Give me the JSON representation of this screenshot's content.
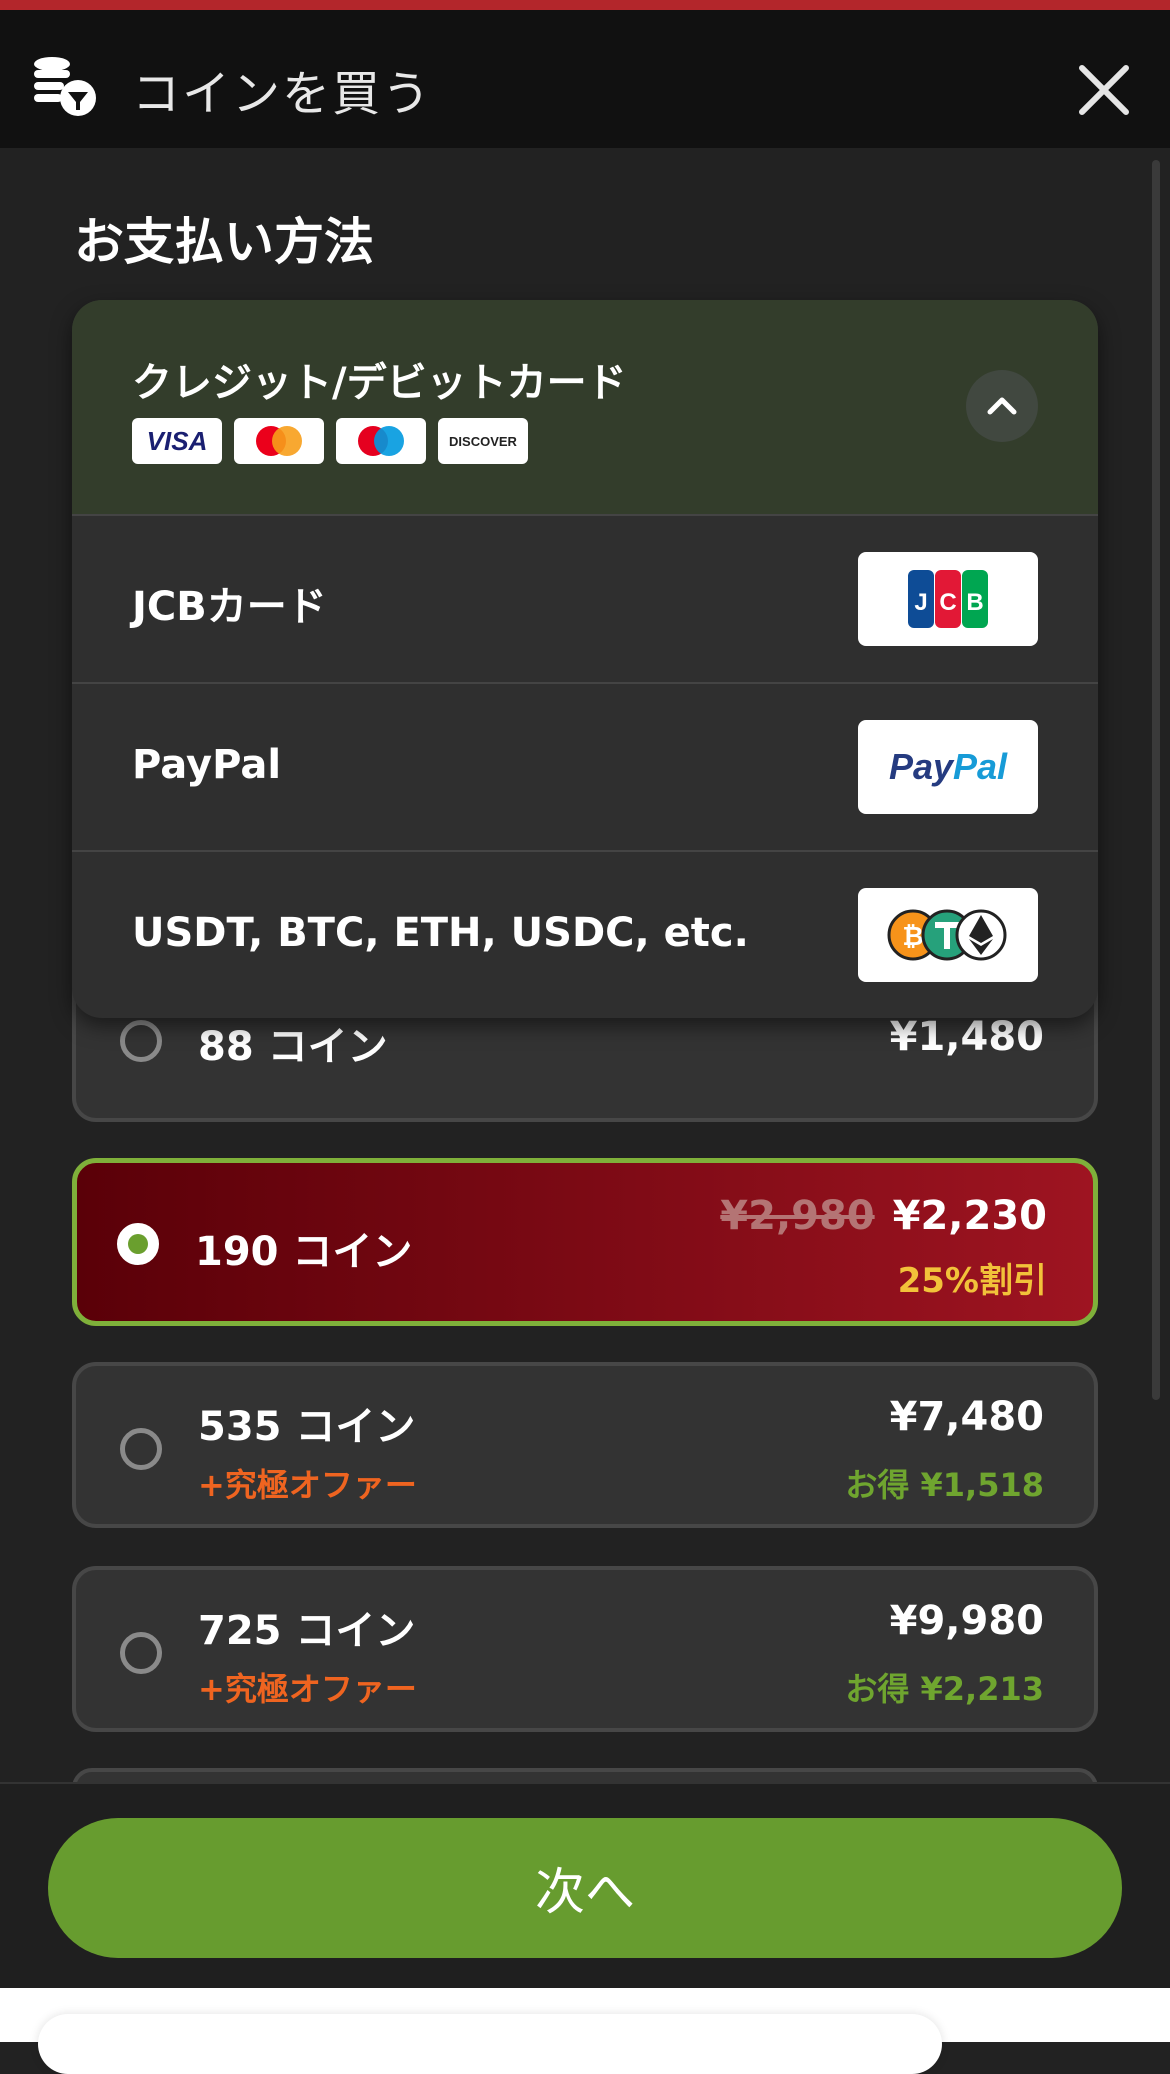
{
  "header": {
    "title": "コインを買う"
  },
  "payment": {
    "section_title": "お支払い方法",
    "selected_method": "クレジット/デビットカード",
    "card_brands": [
      "VISA",
      "Mastercard",
      "Maestro",
      "DISCOVER"
    ],
    "options": [
      {
        "label": "JCBカード",
        "logo": "JCB"
      },
      {
        "label": "PayPal",
        "logo": "PayPal"
      },
      {
        "label": "USDT, BTC, ETH, USDC, etc.",
        "logo": "crypto-icons"
      }
    ]
  },
  "packages": [
    {
      "coins": "88 コイン",
      "price": "¥1,480",
      "selected": false
    },
    {
      "coins": "190 コイン",
      "price": "¥2,230",
      "old_price": "¥2,980",
      "discount": "25%割引",
      "selected": true
    },
    {
      "coins": "535 コイン",
      "price": "¥7,480",
      "offer": "+究極オファー",
      "savings": "お得 ¥1,518",
      "selected": false
    },
    {
      "coins": "725 コイン",
      "price": "¥9,980",
      "offer": "+究極オファー",
      "savings": "お得 ¥2,213",
      "selected": false
    }
  ],
  "footer": {
    "next_label": "次へ"
  },
  "colors": {
    "accent_green": "#679c2f",
    "selected_red": "#9e1421",
    "offer_orange": "#ef6420",
    "top_border": "#b3262b"
  }
}
